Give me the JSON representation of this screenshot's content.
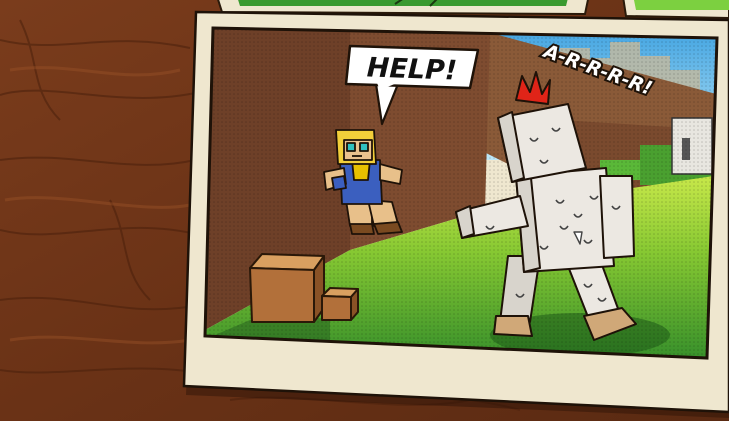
{
  "speech_bubble": {
    "text": "HELP!"
  },
  "sound_effect": {
    "text": "A-R-R-R-R!"
  },
  "colors": {
    "wood": "#6b3418",
    "photo_border": "#efe7cf",
    "wall": "#7a4a2e",
    "grass": "#7cc12e",
    "sky": "#78c8f0",
    "golem": "#ece8e2"
  }
}
